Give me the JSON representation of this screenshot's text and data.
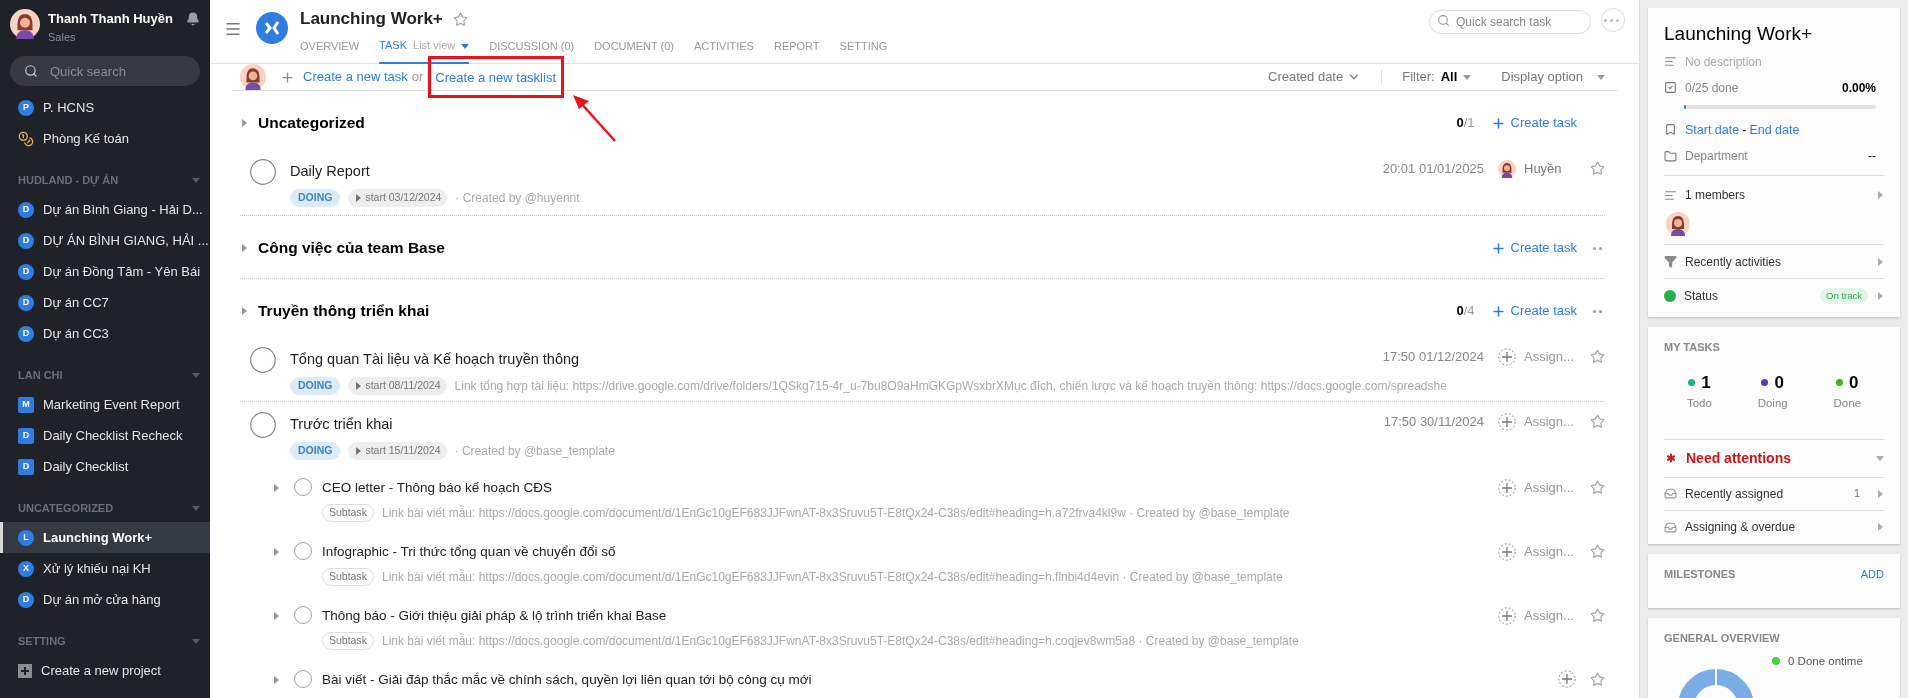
{
  "user": {
    "name": "Thanh Thanh Huyền",
    "role": "Sales"
  },
  "sidebar": {
    "search_placeholder": "Quick search",
    "top_items": [
      {
        "kind": "circle",
        "badge": "P",
        "label": "P. HCNS",
        "selected": false
      },
      {
        "kind": "coins",
        "label": "Phòng Kế toán",
        "selected": false
      }
    ],
    "sections": [
      {
        "title": "HUDLAND - DỰ ÁN",
        "items": [
          {
            "kind": "circle",
            "badge": "D",
            "label": "Dự án Bình Giang - Hải D...",
            "selected": false
          },
          {
            "kind": "circle",
            "badge": "D",
            "label": "DỰ ÁN BÌNH GIANG, HẢI ...",
            "selected": false
          },
          {
            "kind": "circle",
            "badge": "D",
            "label": "Dự án Đồng Tâm - Yên Bái",
            "selected": false
          },
          {
            "kind": "circle",
            "badge": "D",
            "label": "Dự án CC7",
            "selected": false
          },
          {
            "kind": "circle",
            "badge": "D",
            "label": "Dự án CC3",
            "selected": false
          }
        ]
      },
      {
        "title": "LAN CHI",
        "items": [
          {
            "kind": "square",
            "badge": "M",
            "label": "Marketing Event Report",
            "selected": false
          },
          {
            "kind": "square",
            "badge": "D",
            "label": "Daily Checklist Recheck",
            "selected": false
          },
          {
            "kind": "square",
            "badge": "D",
            "label": "Daily Checklist",
            "selected": false
          }
        ]
      },
      {
        "title": "UNCATEGORIZED",
        "items": [
          {
            "kind": "circle",
            "badge": "L",
            "label": "Launching Work+",
            "selected": true
          },
          {
            "kind": "circle",
            "badge": "X",
            "label": "Xử lý khiếu nại KH",
            "selected": false
          },
          {
            "kind": "circle",
            "badge": "D",
            "label": "Dự án mở cửa hàng",
            "selected": false
          }
        ]
      },
      {
        "title": "SETTING",
        "items": [
          {
            "kind": "plus",
            "label": "Create a new project",
            "selected": false
          }
        ]
      }
    ]
  },
  "project": {
    "title": "Launching Work+",
    "starred": false
  },
  "tabs": [
    {
      "label": "OVERVIEW",
      "selected": false
    },
    {
      "label": "TASK",
      "sub": "List view",
      "selected": true
    },
    {
      "label": "DISCUSSION (0)",
      "selected": false
    },
    {
      "label": "DOCUMENT (0)",
      "selected": false
    },
    {
      "label": "ACTIVITIES",
      "selected": false
    },
    {
      "label": "REPORT",
      "selected": false
    },
    {
      "label": "SETTING",
      "selected": false
    }
  ],
  "search_task": {
    "placeholder": "Quick search task"
  },
  "composer": {
    "create_task": "Create a new task",
    "or": "or",
    "create_tasklist": "Create a new tasklist",
    "highlighted": true
  },
  "toolbar": {
    "sort": "Created date",
    "filter_label": "Filter:",
    "filter_value": "All",
    "display": "Display option"
  },
  "tasklists": [
    {
      "title": "Uncategorized",
      "done": "0",
      "total": "/1",
      "create": "Create task",
      "more": false,
      "tasks": [
        {
          "kind": "task",
          "title": "Daily Report",
          "done": false,
          "status": "DOING",
          "start": "start 03/12/2024",
          "note": "· Created by @huyennt",
          "time": "20:01 01/01/2025",
          "assignee": "Huyền",
          "assigned": true,
          "starred": false
        }
      ]
    },
    {
      "title": "Công việc của team Base",
      "create": "Create task",
      "more": true
    },
    {
      "title": "Truyền thông triển khai",
      "done": "0",
      "total": "/4",
      "create": "Create task",
      "more": true,
      "tasks": [
        {
          "kind": "task",
          "title": "Tổng quan Tài liệu và Kế hoạch truyền thông",
          "done": false,
          "status": "DOING",
          "start": "start 08/11/2024",
          "note": "Link tổng hợp tài liệu: https://drive.google.com/drive/folders/1QSkg715-4r_u-7bu8O9aHmGKGpWsxbrXMục đích, chiến lược và kế hoạch truyền thông: https://docs.google.com/spreadshe",
          "time": "17:50 01/12/2024",
          "assignee": "Assign...",
          "assigned": false,
          "starred": false
        },
        {
          "kind": "task",
          "title": "Trước triển khai",
          "done": false,
          "status": "DOING",
          "start": "start 15/11/2024",
          "note": "· Created by @base_template",
          "time": "17:50 30/11/2024",
          "assignee": "Assign...",
          "assigned": false,
          "starred": false
        },
        {
          "kind": "subtask",
          "title": "CEO letter - Thông báo kế hoạch CĐS",
          "done": false,
          "tag": "Subtask",
          "note": "Link bài viết mẫu: https://docs.google.com/document/d/1EnGc10gEF683JJFwnAT-8x3Sruvu5T-E8tQx24-C38s/edit#heading=h.a72frva4kl9w · Created by @base_template",
          "assignee": "Assign...",
          "assigned": false,
          "starred": false
        },
        {
          "kind": "subtask",
          "title": "Infographic - Tri thức tổng quan về chuyển đổi số",
          "done": false,
          "tag": "Subtask",
          "note": "Link bài viết mẫu: https://docs.google.com/document/d/1EnGc10gEF683JJFwnAT-8x3Sruvu5T-E8tQx24-C38s/edit#heading=h.flnbi4d4evin · Created by @base_template",
          "assignee": "Assign...",
          "assigned": false,
          "starred": false
        },
        {
          "kind": "subtask",
          "title": "Thông báo - Giới thiệu giải pháp & lộ trình triển khai Base",
          "done": false,
          "tag": "Subtask",
          "note": "Link bài viết mẫu: https://docs.google.com/document/d/1EnGc10gEF683JJFwnAT-8x3Sruvu5T-E8tQx24-C38s/edit#heading=h.coqjev8wm5a8 · Created by @base_template",
          "assignee": "Assign...",
          "assigned": false,
          "starred": false
        },
        {
          "kind": "subtask",
          "title": "Bài viết - Giải đáp thắc mắc về chính sách, quyền lợi liên quan tới bộ công cụ mới",
          "done": false,
          "assigned": false,
          "starred": false
        }
      ]
    }
  ],
  "summary": {
    "title": "Launching Work+",
    "description": "No description",
    "progress_text": "0/25 done",
    "percent": "0.00%",
    "level": 0,
    "start": "Start date",
    "sep": "-",
    "end": "End date",
    "department_label": "Department",
    "department_value": "--",
    "members": "1 members",
    "recent": "Recently activities",
    "status": {
      "label": "Status",
      "value": "On track",
      "color": "#22b14c"
    }
  },
  "my_tasks": {
    "title": "MY TASKS",
    "stats": [
      {
        "count": "1",
        "label": "Todo",
        "color": "#1db385"
      },
      {
        "count": "0",
        "label": "Doing",
        "color": "#4b3fbd"
      },
      {
        "count": "0",
        "label": "Done",
        "color": "#3cb521"
      }
    ],
    "attention": "Need attentions",
    "rows": [
      {
        "label": "Recently assigned",
        "count": "1"
      },
      {
        "label": "Assigning & overdue"
      }
    ]
  },
  "milestones": {
    "title": "MILESTONES",
    "action": "ADD"
  },
  "overview": {
    "title": "GENERAL OVERVIEW",
    "legend": [
      {
        "label": "0 Done ontime",
        "color": "#46d046"
      }
    ]
  }
}
